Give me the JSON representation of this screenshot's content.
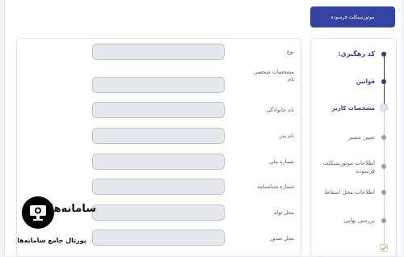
{
  "header": {
    "badge": "موتورسیکلت فرسوده"
  },
  "form": {
    "fields": [
      {
        "label": "نوع",
        "value": ""
      },
      {
        "label": "مشخصات شخصی\nنام",
        "value": ""
      },
      {
        "label": "نام خانوادگی",
        "value": ""
      },
      {
        "label": "نام پدر",
        "value": ""
      },
      {
        "label": "شماره ملی",
        "value": ""
      },
      {
        "label": "شماره شناسنامه",
        "value": ""
      },
      {
        "label": "محل تولد",
        "value": ""
      },
      {
        "label": "محل صدور",
        "value": ""
      }
    ]
  },
  "steps": [
    {
      "label": "کد رهگیری:",
      "state": "done"
    },
    {
      "label": "قوانین",
      "state": "done"
    },
    {
      "label": "مشخصات کاربر",
      "state": "current"
    },
    {
      "label": "تعیین مسیر",
      "state": "pending"
    },
    {
      "label": "اطلاعات موتورسیکلت فرسوده",
      "state": "pending"
    },
    {
      "label": "اطلاعات محل اسقاط",
      "state": "pending"
    },
    {
      "label": "بررسی نهایی",
      "state": "pending"
    }
  ],
  "logo": {
    "title": "سامانه‌ها",
    "subtitle": "پورتال جامع سامانه‌ها"
  },
  "colors": {
    "primary": "#3342a3",
    "input_bg": "#e7e8ed",
    "muted": "#9a9ca6"
  }
}
